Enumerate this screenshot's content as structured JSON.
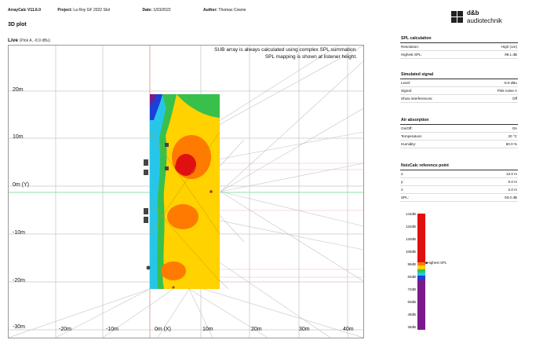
{
  "header": {
    "app": "ArrayCalc V11.6.0",
    "project_label": "Project:",
    "project": "La Roy GF 2022 Stol",
    "date_label": "Date:",
    "date": "1/03/2022",
    "author_label": "Author:",
    "author": "Thomas Cowne"
  },
  "logo": {
    "line1": "d&b",
    "line2": "audiotechnik"
  },
  "plot": {
    "title": "3D plot",
    "mode": "Live",
    "mode_detail": "(Pink A, -8.9 dBu)",
    "note_line1": "SUB array is always calculated using complex SPL summation.",
    "note_line2": "SPL mapping is shown at listener height.",
    "y_ticks": [
      "20m",
      "10m",
      "0m (Y)",
      "-10m",
      "-20m",
      "-30m"
    ],
    "x_ticks": [
      "-20m",
      "-10m",
      "0m (X)",
      "10m",
      "20m",
      "30m",
      "40m"
    ]
  },
  "panels": {
    "spl_calc": {
      "title": "SPL calculation",
      "rows": [
        {
          "k": "Resolution:",
          "v": "High (1m)"
        },
        {
          "k": "Highest SPL:",
          "v": "99.1 dB"
        }
      ]
    },
    "signal": {
      "title": "Simulated signal",
      "rows": [
        {
          "k": "Level:",
          "v": "-8.9 dBu"
        },
        {
          "k": "Signal:",
          "v": "Pink noise A"
        },
        {
          "k": "Show interferences:",
          "v": "Off"
        }
      ]
    },
    "air": {
      "title": "Air absorption",
      "rows": [
        {
          "k": "On/Off:",
          "v": "On"
        },
        {
          "k": "Temperature:",
          "v": "20 °C"
        },
        {
          "k": "Humidity:",
          "v": "60.0 %"
        }
      ]
    },
    "noizcalc": {
      "title": "NoizCalc reference point",
      "rows": [
        {
          "k": "x:",
          "v": "13.0 m"
        },
        {
          "k": "y:",
          "v": "0.0 m"
        },
        {
          "k": "z:",
          "v": "2.0 m"
        },
        {
          "k": "SPL:",
          "v": "93.0 dB"
        }
      ]
    }
  },
  "colorbar": {
    "labels": [
      "144dB",
      "132dB",
      "120dB",
      "108dB",
      "96dB",
      "84dB",
      "72dB",
      "60dB",
      "48dB",
      "36dB"
    ],
    "highest_label": "Highest SPL"
  },
  "colors": {
    "red": "#e01010",
    "orange": "#ff7a00",
    "yellow": "#ffd200",
    "green": "#39c04a",
    "cyan": "#27c6e8",
    "blue": "#1c3fd6",
    "purple": "#7a1a8c"
  }
}
